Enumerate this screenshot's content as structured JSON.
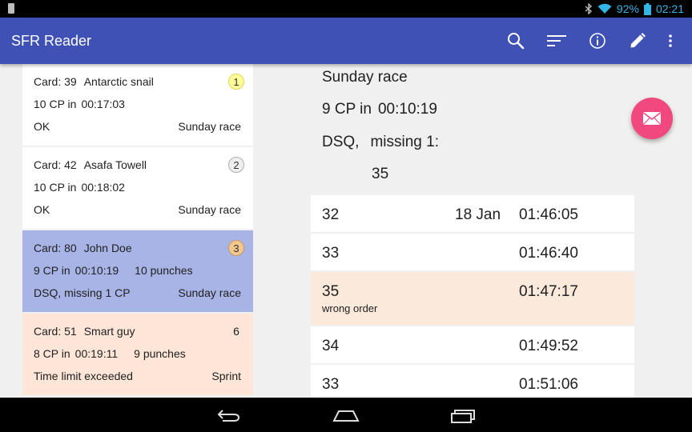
{
  "status_bar": {
    "battery": "92%",
    "time": "02:21"
  },
  "app_bar": {
    "title": "SFR Reader",
    "primary_color": "#3f51b5"
  },
  "actions": [
    "search-icon",
    "sort-icon",
    "info-icon",
    "edit-icon",
    "overflow-menu-icon"
  ],
  "cards": [
    {
      "card": "Card: 39",
      "name": "Antarctic snail",
      "position": "1",
      "cp": "10 CP in",
      "time": "00:17:03",
      "punches": "",
      "status": "OK",
      "race": "Sunday race",
      "bg": "#ffffff",
      "badge": "gold"
    },
    {
      "card": "Card: 42",
      "name": "Asafa Towell",
      "position": "2",
      "cp": "10 CP in",
      "time": "00:18:02",
      "punches": "",
      "status": "OK",
      "race": "Sunday race",
      "bg": "#ffffff",
      "badge": "silver"
    },
    {
      "card": "Card: 80",
      "name": "John Doe",
      "position": "3",
      "cp": "9 CP in",
      "time": "00:10:19",
      "punches": "10 punches",
      "status": "DSQ, missing 1 CP",
      "race": "Sunday race",
      "bg": "#a8b3e6",
      "badge": "bronze"
    },
    {
      "card": "Card: 51",
      "name": "Smart guy",
      "position": "6",
      "cp": "8 CP in",
      "time": "00:19:11",
      "punches": "9 punches",
      "status": "Time limit exceeded",
      "race": "Sprint",
      "bg": "#fde6d8",
      "badge": "none"
    }
  ],
  "detail": {
    "race": "Sunday race",
    "summary_cp": "9 CP in",
    "summary_time": "00:10:19",
    "status": "DSQ,",
    "missing": "missing 1:",
    "missing_cp": "35",
    "punches": [
      {
        "cp": "32",
        "date": "18 Jan",
        "time": "01:46:05",
        "note": "",
        "highlight": false
      },
      {
        "cp": "33",
        "date": "",
        "time": "01:46:40",
        "note": "",
        "highlight": false
      },
      {
        "cp": "35",
        "date": "",
        "time": "01:47:17",
        "note": "wrong order",
        "highlight": true
      },
      {
        "cp": "34",
        "date": "",
        "time": "01:49:52",
        "note": "",
        "highlight": false
      },
      {
        "cp": "33",
        "date": "",
        "time": "01:51:06",
        "note": "",
        "highlight": false
      }
    ]
  },
  "fab": {
    "icon": "email-icon",
    "color": "#f0487f"
  },
  "nav": [
    "back-icon",
    "home-icon",
    "recent-apps-icon"
  ]
}
